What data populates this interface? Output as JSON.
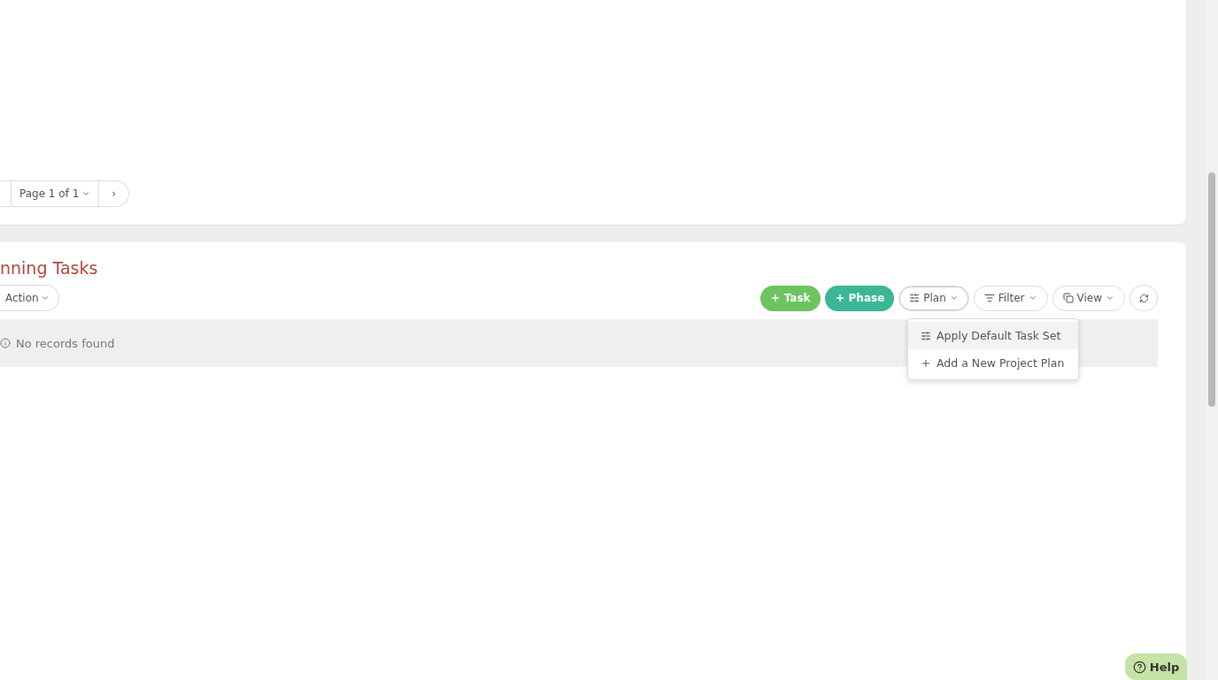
{
  "pagination": {
    "page_label": "Page 1 of 1",
    "next": "›"
  },
  "section": {
    "title": "nning Tasks",
    "action": "Action",
    "empty_message": "No records found"
  },
  "toolbar": [
    {
      "kind": "add",
      "label": "Task",
      "color": "#6cc35f"
    },
    {
      "kind": "add",
      "label": "Phase",
      "color": "#3bb795"
    },
    {
      "kind": "menu",
      "label": "Plan",
      "expanded": true
    },
    {
      "kind": "menu",
      "label": "Filter",
      "expanded": false
    },
    {
      "kind": "menu",
      "label": "View",
      "expanded": false
    },
    {
      "kind": "refresh"
    }
  ],
  "plan_menu": [
    {
      "label": "Apply Default Task Set",
      "selected": true
    },
    {
      "label": "Add a New Project Plan",
      "selected": false
    }
  ],
  "help": {
    "label": "Help"
  }
}
